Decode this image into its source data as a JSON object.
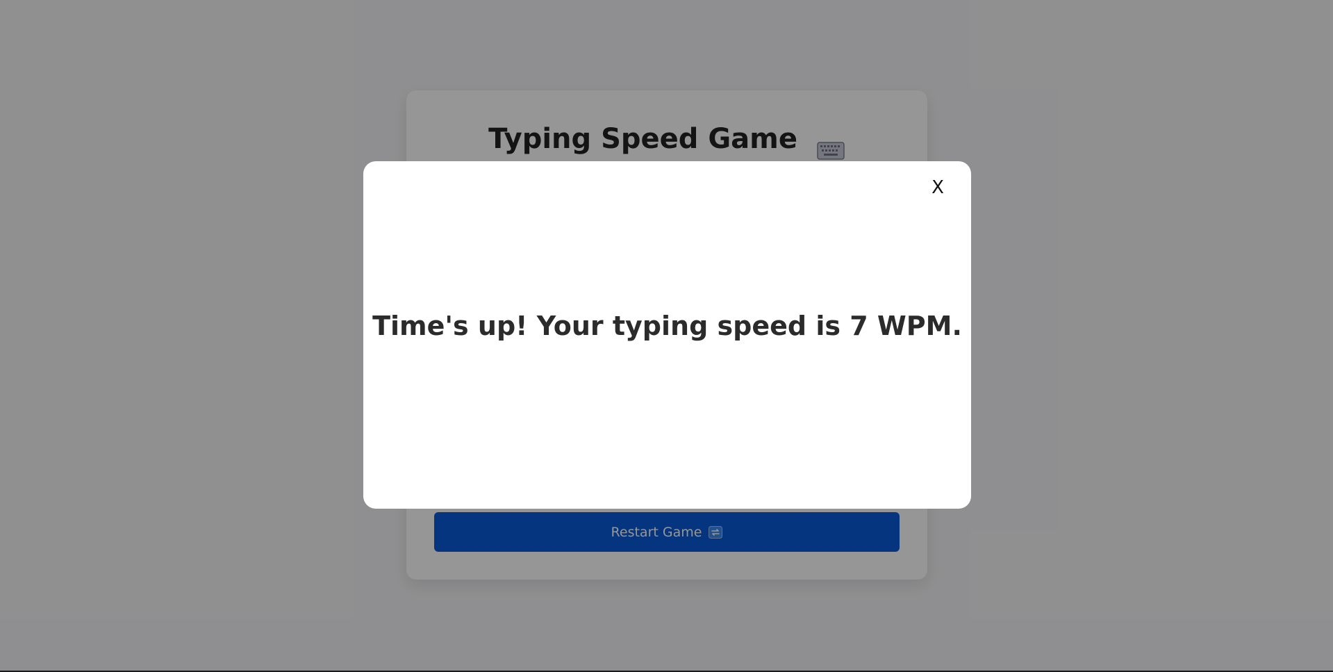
{
  "game": {
    "title": "Typing Speed Game",
    "title_icon": "keyboard-icon",
    "restart_label": "Restart Game",
    "restart_icon": "repeat-icon"
  },
  "modal": {
    "close_label": "X",
    "message": "Time's up! Your typing speed is 7 WPM."
  },
  "colors": {
    "primary_button": "#0a5ad6",
    "overlay": "rgba(0,0,0,0.41)",
    "modal_background": "#ffffff"
  }
}
